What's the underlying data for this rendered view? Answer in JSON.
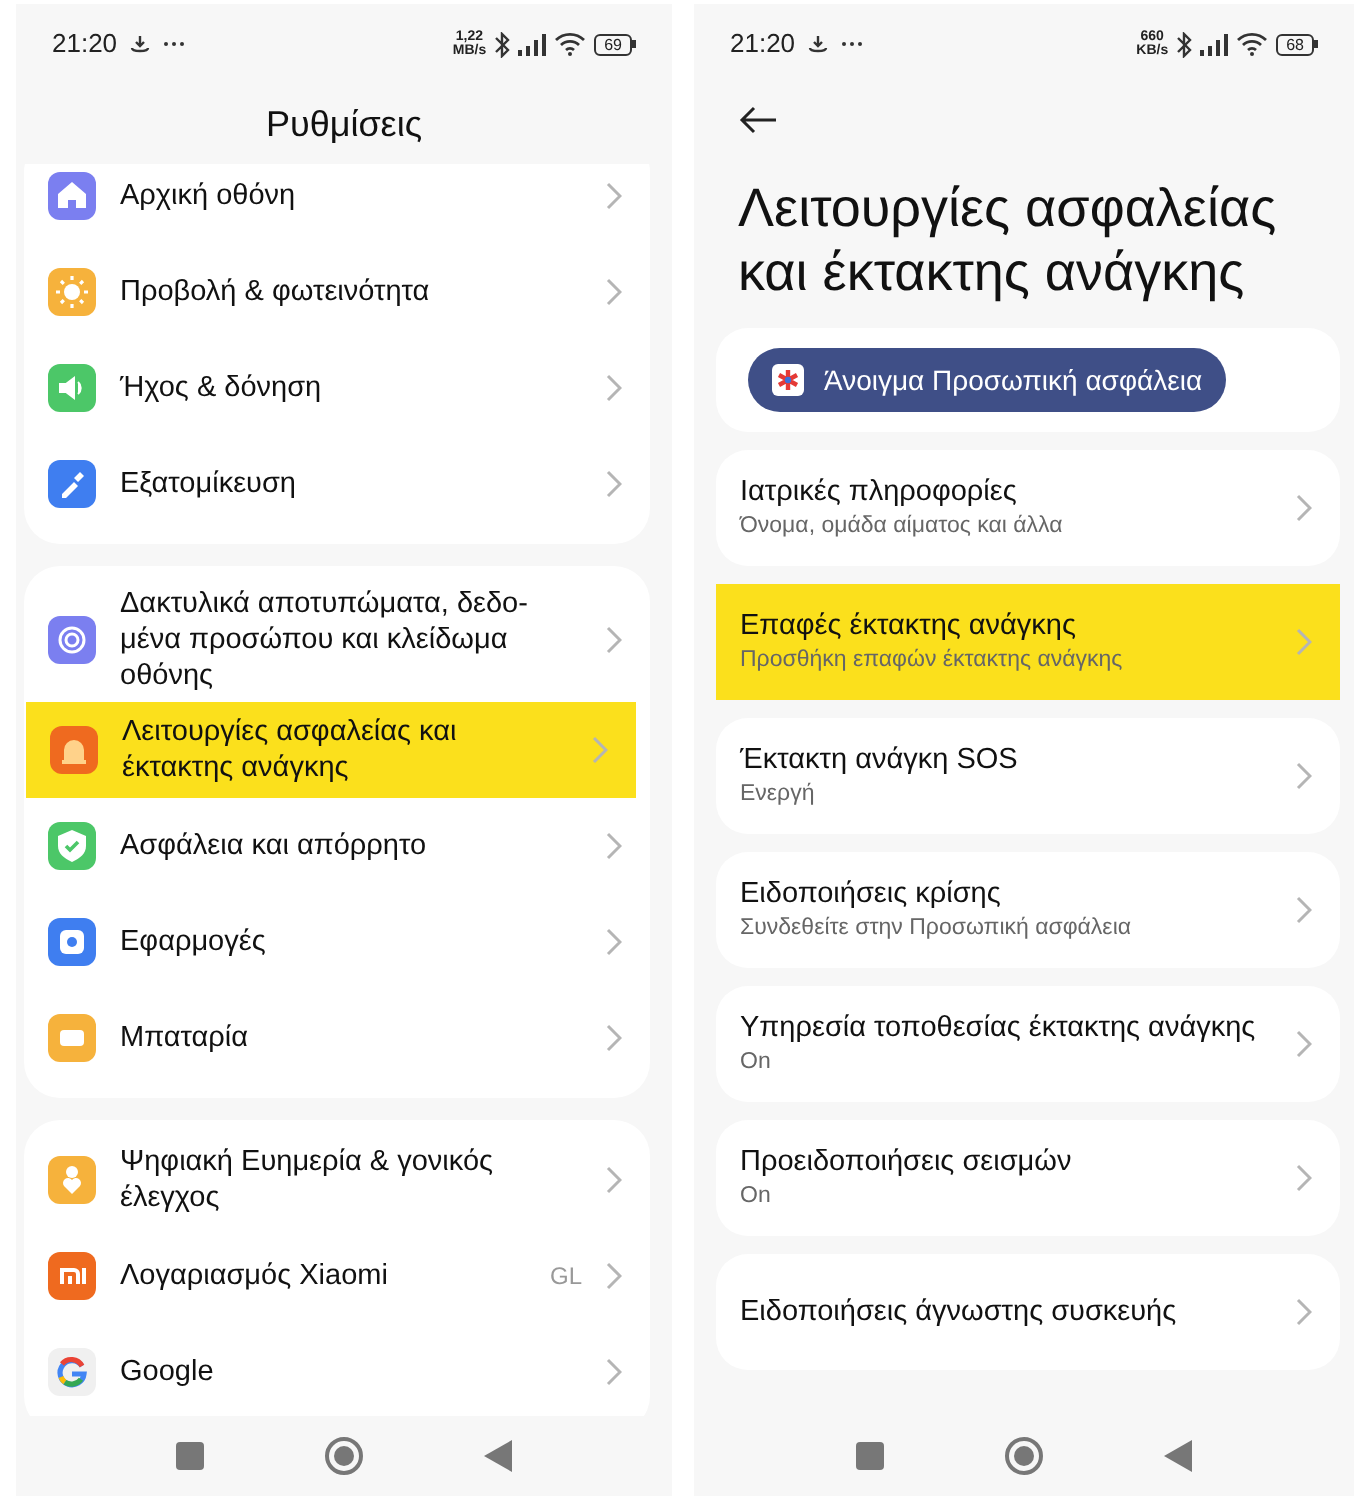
{
  "left_screen": {
    "status_bar": {
      "time": "21:20",
      "speed_value": "1,22",
      "speed_unit": "MB/s",
      "battery": "69"
    },
    "title": "Ρυθμίσεις",
    "groups": [
      {
        "items": [
          {
            "label": "Αρχική οθόνη",
            "selected": false
          },
          {
            "label": "Προβολή & φωτεινότητα",
            "selected": false
          },
          {
            "label": "Ήχος & δόνηση",
            "selected": false
          },
          {
            "label": "Εξατομίκευση",
            "selected": false
          }
        ]
      },
      {
        "items": [
          {
            "label": "Δακτυλικά αποτυπώματα, δεδο-μένα προσώπου και κλείδωμα οθόνης",
            "selected": false
          },
          {
            "label": "Λειτουργίες ασφαλείας και έκτακτης ανάγκης",
            "selected": true
          },
          {
            "label": "Ασφάλεια και απόρρητο",
            "selected": false
          },
          {
            "label": "Εφαρμογές",
            "selected": false
          },
          {
            "label": "Μπαταρία",
            "selected": false
          }
        ]
      },
      {
        "items": [
          {
            "label": "Ψηφιακή Ευημερία & γονικός έλεγχος",
            "selected": false
          },
          {
            "label": "Λογαριασμός Xiaomi",
            "value": "GL",
            "selected": false
          },
          {
            "label": "Google",
            "selected": false
          }
        ]
      }
    ]
  },
  "right_screen": {
    "status_bar": {
      "time": "21:20",
      "speed_value": "660",
      "speed_unit": "KB/s",
      "battery": "68"
    },
    "title": "Λειτουργίες ασφαλείας και έκτακτης ανάγκης",
    "open_button": "Άνοιγμα Προσωπική ασφάλεια",
    "items": [
      {
        "title": "Ιατρικές πληροφορίες",
        "subtitle": "Όνομα, ομάδα αίματος και άλλα",
        "selected": false
      },
      {
        "title": "Επαφές έκτακτης ανάγκης",
        "subtitle": "Προσθήκη επαφών έκτακτης ανάγκης",
        "selected": true
      },
      {
        "title": "Έκτακτη ανάγκη SOS",
        "subtitle": "Ενεργή",
        "selected": false
      },
      {
        "title": "Ειδοποιήσεις κρίσης",
        "subtitle": "Συνδεθείτε στην Προσωπική ασφάλεια",
        "selected": false
      },
      {
        "title": "Υπηρεσία τοποθεσίας έκτακτης ανάγκης",
        "subtitle": "On",
        "selected": false
      },
      {
        "title": "Προειδοποιήσεις σεισμών",
        "subtitle": "On",
        "selected": false
      },
      {
        "title": "Ειδοποιήσεις άγνωστης συσκευής",
        "selected": false
      }
    ]
  }
}
